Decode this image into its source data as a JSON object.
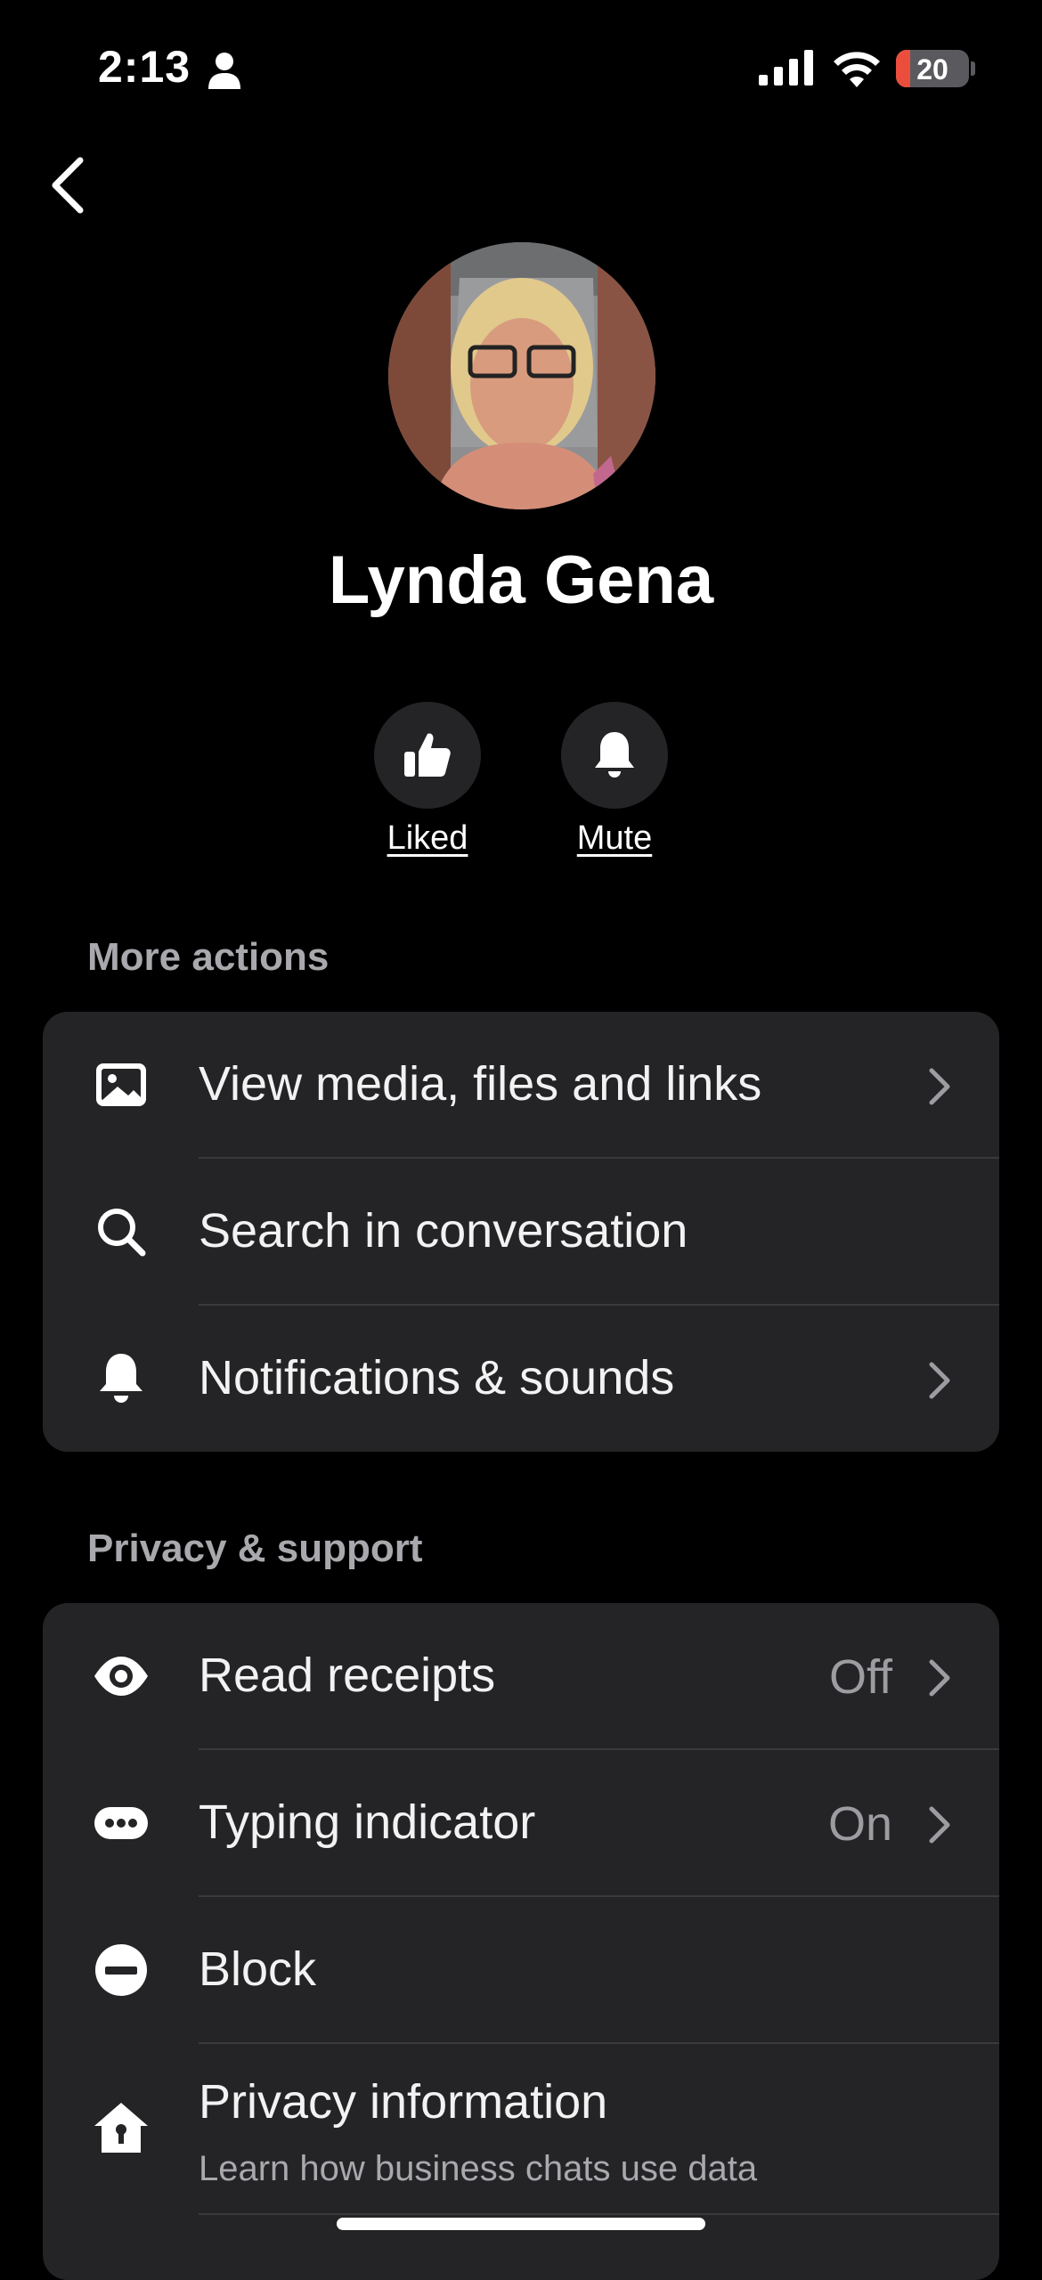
{
  "status_bar": {
    "time": "2:13",
    "battery": "20"
  },
  "profile": {
    "name": "Lynda Gena"
  },
  "actions": {
    "liked_label": "Liked",
    "mute_label": "Mute"
  },
  "more_actions": {
    "header": "More actions",
    "items": [
      {
        "label": "View media, files and links",
        "icon": "image-icon",
        "has_chevron": true
      },
      {
        "label": "Search in conversation",
        "icon": "search-icon",
        "has_chevron": false
      },
      {
        "label": "Notifications & sounds",
        "icon": "bell-icon",
        "has_chevron": true
      }
    ]
  },
  "privacy_support": {
    "header": "Privacy & support",
    "items": [
      {
        "label": "Read receipts",
        "value": "Off",
        "icon": "eye-icon",
        "has_chevron": true
      },
      {
        "label": "Typing indicator",
        "value": "On",
        "icon": "typing-bubble-icon",
        "has_chevron": true
      },
      {
        "label": "Block",
        "icon": "block-icon",
        "has_chevron": false
      },
      {
        "label": "Privacy information",
        "sublabel": "Learn how business chats use data",
        "icon": "home-lock-icon",
        "has_chevron": false
      }
    ]
  },
  "colors": {
    "background": "#000000",
    "card": "#242426",
    "secondary_text": "#a8a8ad",
    "battery_low": "#eb4e3d"
  }
}
